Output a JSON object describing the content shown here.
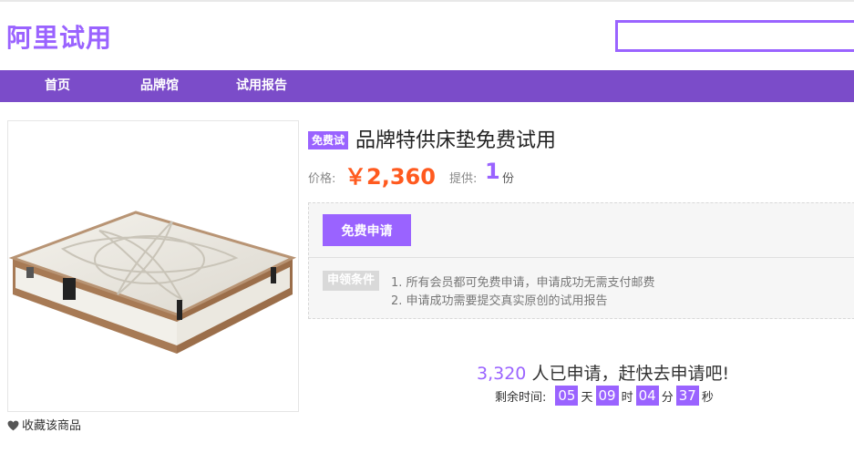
{
  "header": {
    "logo": "阿里试用",
    "search_placeholder": ""
  },
  "nav": {
    "items": [
      "首页",
      "品牌馆",
      "试用报告"
    ]
  },
  "product": {
    "badge": "免费试",
    "title": "品牌特供床垫免费试用",
    "price_label": "价格:",
    "price": "￥2,360",
    "supply_label": "提供:",
    "supply_num": "1",
    "supply_unit": "份",
    "apply_button": "免费申请",
    "conditions_label": "申领条件",
    "conditions": [
      "1. 所有会员都可免费申请，申请成功无需支付邮费",
      "2. 申请成功需要提交真实原创的试用报告"
    ],
    "applicants_count": "3,320",
    "applicants_text": " 人已申请，赶快去申请吧!",
    "countdown_label": "剩余时间:",
    "countdown": {
      "days": "05",
      "hours": "09",
      "minutes": "04",
      "seconds": "37"
    },
    "units": {
      "days": "天",
      "hours": "时",
      "minutes": "分",
      "seconds": "秒"
    },
    "favorite": "收藏该商品"
  },
  "colors": {
    "brand": "#9a63ff",
    "nav": "#7b4cc9",
    "price": "#ff5a1f"
  }
}
